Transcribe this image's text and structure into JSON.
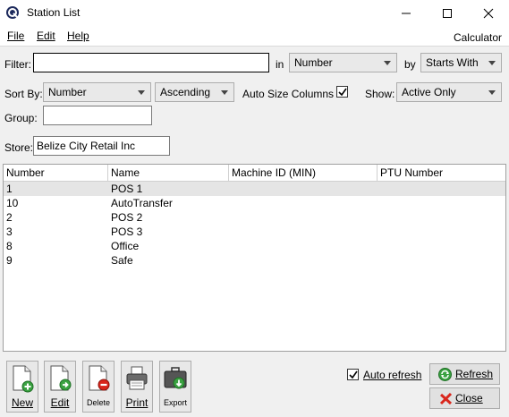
{
  "window": {
    "title": "Station List",
    "icon": "app-logo-icon",
    "controls": [
      "minimize-icon",
      "maximize-icon",
      "close-icon"
    ]
  },
  "menu": {
    "file": "File",
    "edit": "Edit",
    "help": "Help",
    "calculator": "Calculator"
  },
  "filter": {
    "label": "Filter:",
    "value": "",
    "in_label": "in",
    "in_value": "Number",
    "by_label": "by",
    "by_value": "Starts With"
  },
  "sort": {
    "label": "Sort By:",
    "field": "Number",
    "order": "Ascending",
    "autosize_label": "Auto Size Columns",
    "autosize_checked": true,
    "show_label": "Show:",
    "show_value": "Active Only"
  },
  "group": {
    "label": "Group:",
    "value": ""
  },
  "store": {
    "label": "Store:",
    "value": "Belize City Retail Inc"
  },
  "grid": {
    "columns": [
      "Number",
      "Name",
      "Machine ID (MIN)",
      "PTU Number"
    ],
    "rows": [
      {
        "number": "1",
        "name": "POS 1",
        "machine_id": "",
        "ptu": ""
      },
      {
        "number": "10",
        "name": "AutoTransfer",
        "machine_id": "",
        "ptu": ""
      },
      {
        "number": "2",
        "name": "POS 2",
        "machine_id": "",
        "ptu": ""
      },
      {
        "number": "3",
        "name": "POS 3",
        "machine_id": "",
        "ptu": ""
      },
      {
        "number": "8",
        "name": "Office",
        "machine_id": "",
        "ptu": ""
      },
      {
        "number": "9",
        "name": "Safe",
        "machine_id": "",
        "ptu": ""
      }
    ]
  },
  "toolbar": {
    "new": "New",
    "edit": "Edit",
    "delete": "Delete",
    "print": "Print",
    "export": "Export"
  },
  "bottom": {
    "auto_refresh_label": "Auto refresh",
    "auto_refresh_checked": true,
    "refresh": "Refresh",
    "close": "Close"
  },
  "colors": {
    "accent_green": "#3aa241",
    "delete_red": "#d9261c",
    "selected_row": "#e5e5e5"
  }
}
